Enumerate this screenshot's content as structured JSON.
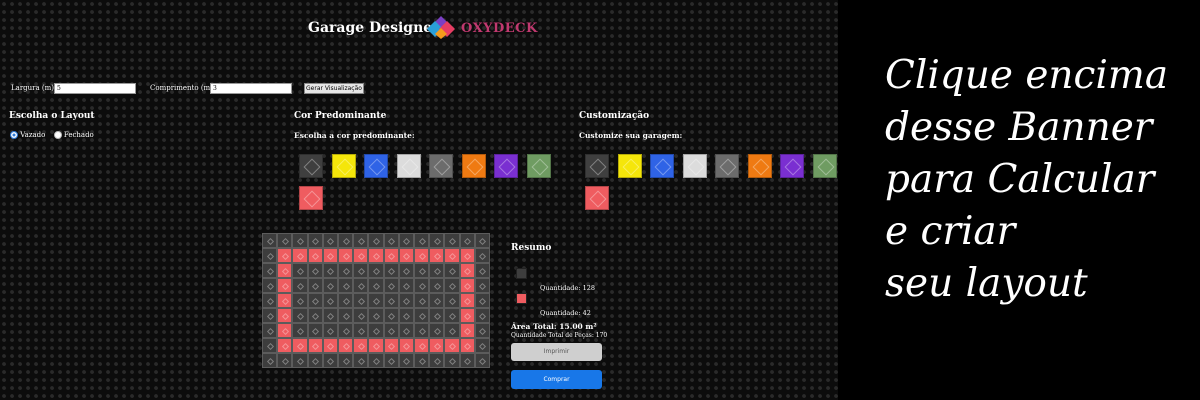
{
  "header": {
    "title": "Garage Designer",
    "logo_text": "OXYDECK"
  },
  "dimensions": {
    "width_label": "Largura (m):",
    "width_value": "5",
    "length_label": "Comprimento (m):",
    "length_value": "3",
    "generate_button": "Gerar Visualização"
  },
  "layout": {
    "heading": "Escolha o Layout",
    "options": [
      {
        "label": "Vazado",
        "selected": true
      },
      {
        "label": "Fechado",
        "selected": false
      }
    ]
  },
  "predominant": {
    "heading": "Cor Predominante",
    "subheading": "Escolha a cor predominante:",
    "colors": [
      "#3f3f3f",
      "#f5e60a",
      "#2f63e6",
      "#dcdcdc",
      "#6c6c6c",
      "#ef7a12",
      "#7a2fd1",
      "#6f9c62",
      "#ef5c60"
    ]
  },
  "customization": {
    "heading": "Customização",
    "subheading": "Customize sua garagem:",
    "colors": [
      "#3f3f3f",
      "#f5e60a",
      "#2f63e6",
      "#dcdcdc",
      "#6c6c6c",
      "#ef7a12",
      "#7a2fd1",
      "#6f9c62",
      "#ef5c60"
    ]
  },
  "preview": {
    "cols": 15,
    "rows": 9,
    "base_color": "#3d3d3d",
    "accent_color": "#ef5c60"
  },
  "summary": {
    "heading": "Resumo",
    "items": [
      {
        "color": "#3d3d3d",
        "quantity_text": "Quantidade: 128"
      },
      {
        "color": "#ef5c60",
        "quantity_text": "Quantidade: 42"
      }
    ],
    "area_total": "Área Total: 15.00 m²",
    "pieces_total": "Quantidade Total de Peças: 170",
    "print_button": "Imprimir",
    "buy_button": "Comprar"
  },
  "banner": {
    "lines": [
      "Clique encima",
      "desse Banner",
      "para Calcular",
      "e criar",
      "seu layout"
    ]
  }
}
